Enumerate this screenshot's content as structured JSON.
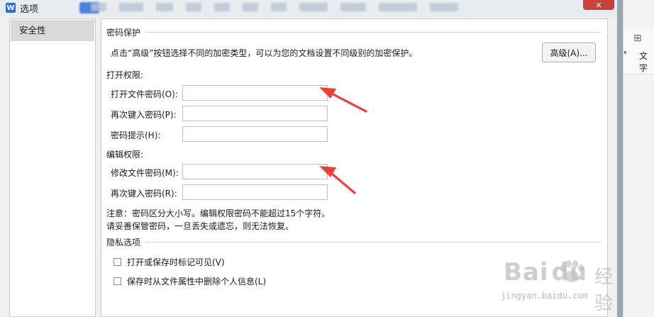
{
  "window": {
    "title": "选项",
    "app_icon_letter": "W"
  },
  "nav": {
    "items": [
      {
        "label": "安全性"
      }
    ]
  },
  "password_protection": {
    "title": "密码保护",
    "description": "点击“高级”按钮选择不同的加密类型，可以为您的文档设置不同级别的加密保护。",
    "advanced_button": "高级(A)..."
  },
  "open_permission": {
    "title": "打开权限:",
    "fields": [
      {
        "label": "打开文件密码(O):",
        "value": ""
      },
      {
        "label": "再次键入密码(P):",
        "value": ""
      },
      {
        "label": "密码提示(H):",
        "value": ""
      }
    ]
  },
  "edit_permission": {
    "title": "编辑权限:",
    "fields": [
      {
        "label": "修改文件密码(M):",
        "value": ""
      },
      {
        "label": "再次键入密码(R):",
        "value": ""
      }
    ]
  },
  "notes": {
    "line1": "注意：密码区分大小写。编辑权限密码不能超过15个字符。",
    "line2": "请妥善保管密码，一旦丢失或遗忘，则无法恢复。"
  },
  "privacy": {
    "title": "隐私选项",
    "options": [
      {
        "label": "打开或保存时标记可见(V)",
        "checked": false
      },
      {
        "label": "保存时从文件属性中删除个人信息(L)",
        "checked": false
      }
    ]
  },
  "right_panel": {
    "text": "文字"
  },
  "watermark": {
    "main": "Bai",
    "paw": "du",
    "cn": "经验",
    "sub": "jingyan.baidu.com"
  },
  "colors": {
    "arrow": "#e8413a",
    "accent": "#2b6fd6"
  }
}
